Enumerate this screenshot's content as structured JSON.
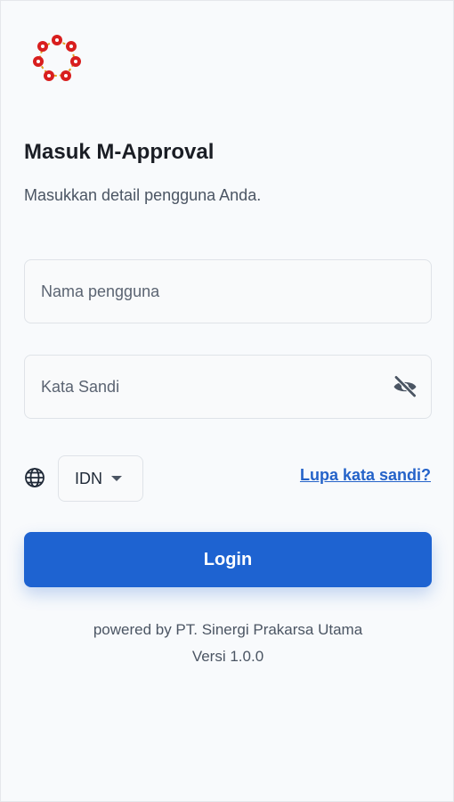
{
  "header": {
    "title": "Masuk M-Approval",
    "subtitle": "Masukkan detail pengguna Anda."
  },
  "form": {
    "username_placeholder": "Nama pengguna",
    "username_value": "",
    "password_placeholder": "Kata Sandi",
    "password_value": "",
    "password_toggle_icon": "eye-off-icon",
    "language_icon": "globe-icon",
    "language_selected": "IDN",
    "forgot_label": "Lupa kata sandi?",
    "login_label": "Login"
  },
  "footer": {
    "powered_by": "powered by PT. Sinergi Prakarsa Utama",
    "version": "Versi 1.0.0"
  },
  "colors": {
    "primary": "#1e63d1",
    "link": "#2563c9",
    "background": "#f8fafc",
    "logo_red": "#d81e1e",
    "logo_gold": "#e0a020"
  }
}
